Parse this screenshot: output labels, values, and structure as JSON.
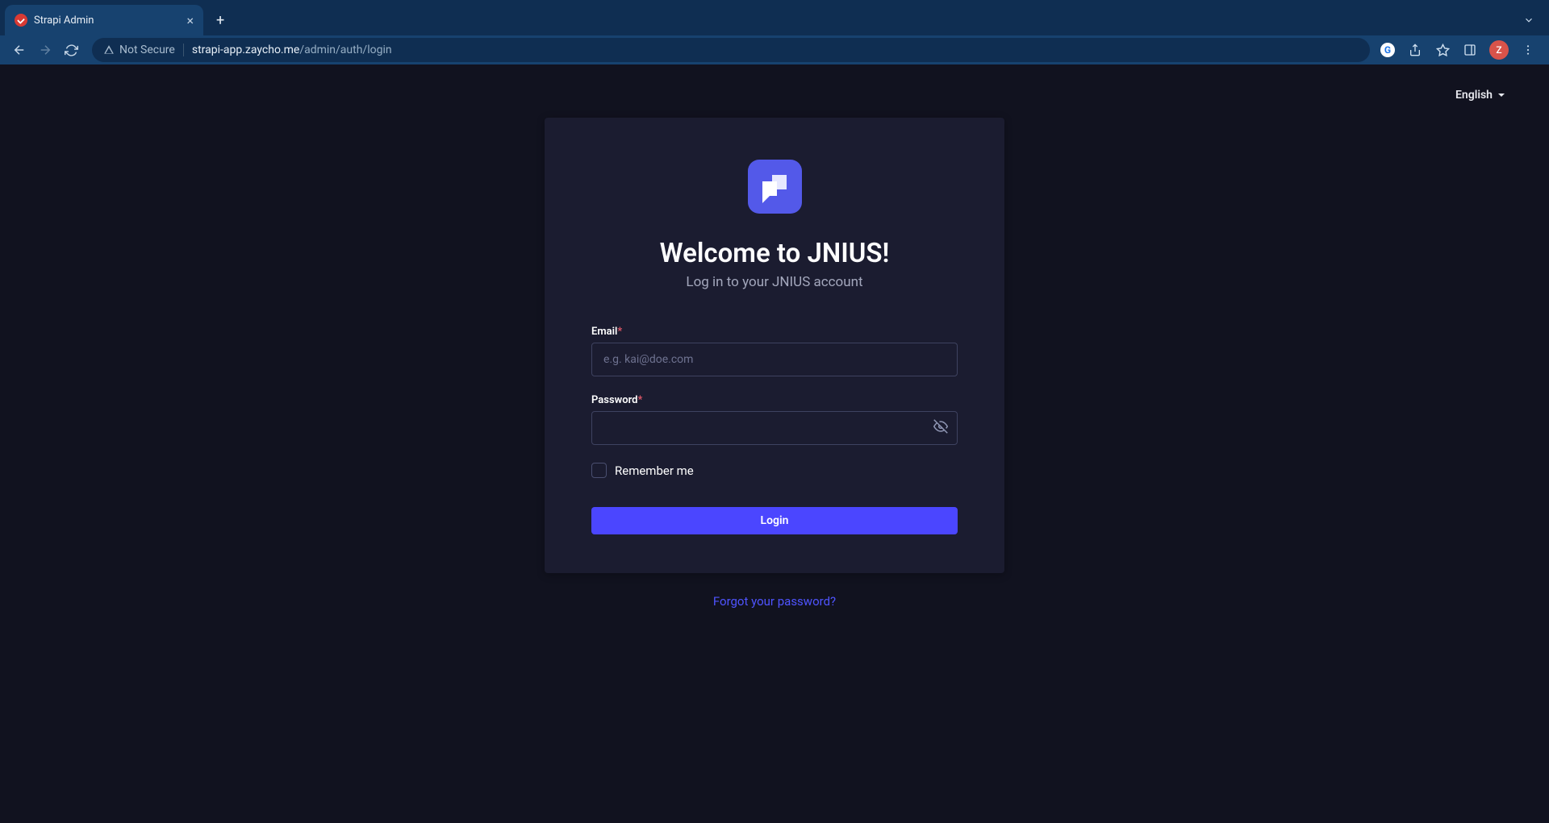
{
  "browser": {
    "tab_title": "Strapi Admin",
    "not_secure_label": "Not Secure",
    "url_host": "strapi-app.zaycho.me",
    "url_path": "/admin/auth/login",
    "avatar_letter": "Z"
  },
  "lang": {
    "selected": "English"
  },
  "login": {
    "title": "Welcome to JNIUS!",
    "subtitle": "Log in to your JNIUS account",
    "email_label": "Email",
    "email_placeholder": "e.g. kai@doe.com",
    "password_label": "Password",
    "remember_label": "Remember me",
    "submit_label": "Login",
    "forgot_label": "Forgot your password?"
  },
  "colors": {
    "accent": "#4b46ff",
    "logo_bg": "#5359e9",
    "card_bg": "#1b1c30",
    "page_bg": "#11121f"
  }
}
